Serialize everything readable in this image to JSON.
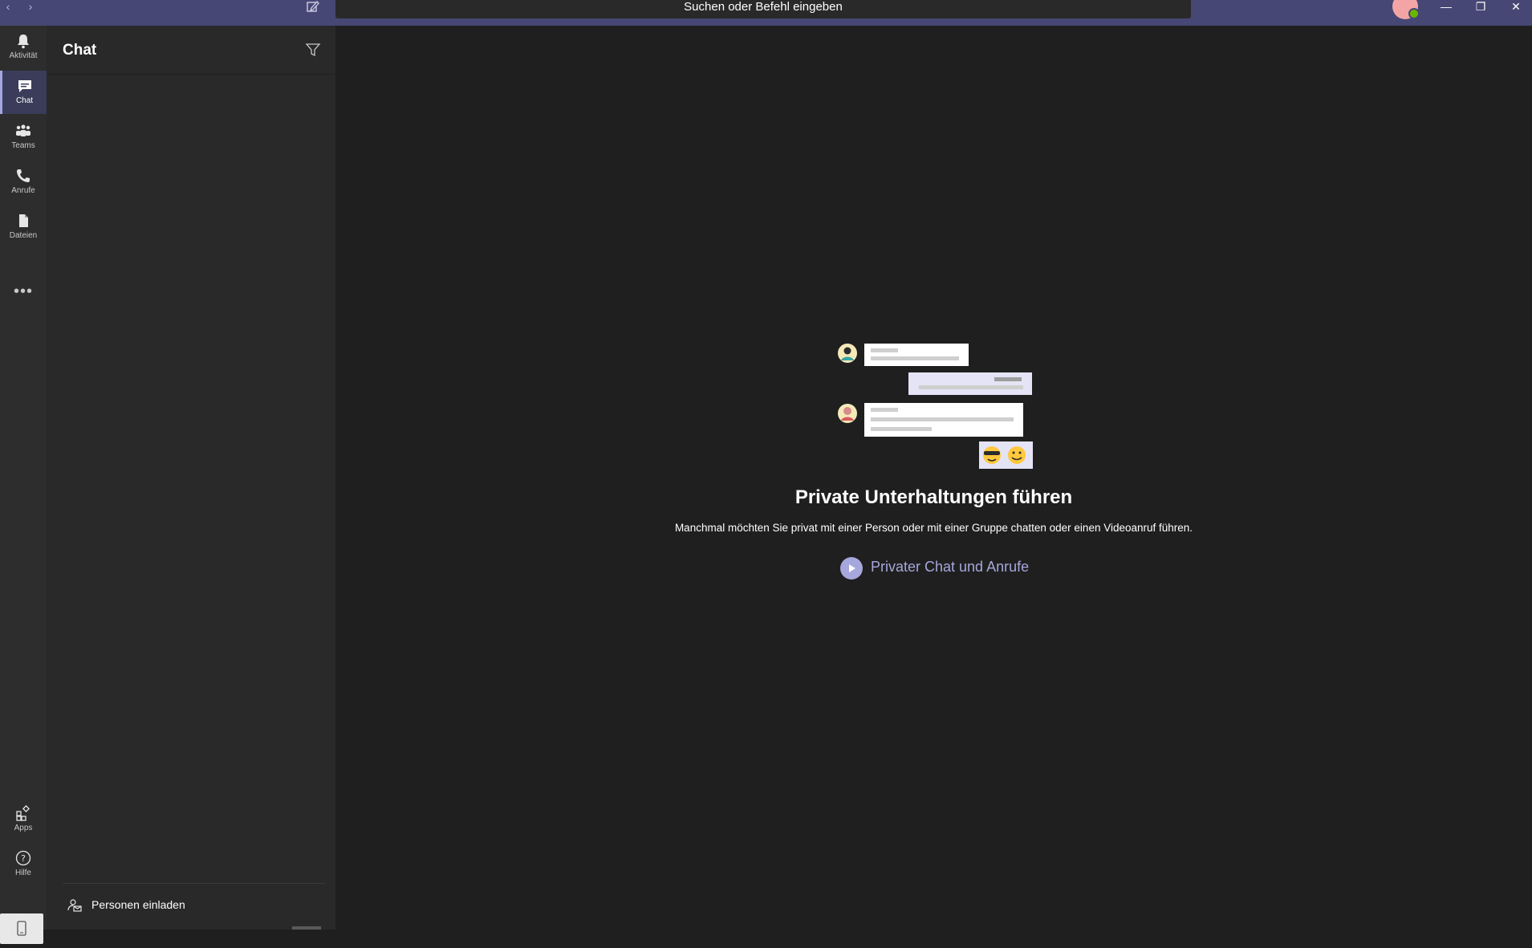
{
  "titlebar": {
    "search_placeholder": "Suchen oder Befehl eingeben",
    "back_icon": "chevron-left",
    "forward_icon": "chevron-right",
    "compose_icon": "new-chat",
    "window_controls": [
      "minimize",
      "restore",
      "close"
    ]
  },
  "rail": {
    "items": [
      {
        "label": "Aktivität",
        "icon": "bell"
      },
      {
        "label": "Chat",
        "icon": "chat-bubble"
      },
      {
        "label": "Teams",
        "icon": "teams"
      },
      {
        "label": "Anrufe",
        "icon": "phone"
      },
      {
        "label": "Dateien",
        "icon": "file"
      }
    ],
    "more": "•••",
    "bottom": [
      {
        "label": "Apps",
        "icon": "apps"
      },
      {
        "label": "Hilfe",
        "icon": "help"
      }
    ],
    "active": "Chat"
  },
  "chat_panel": {
    "title": "Chat",
    "filter_icon": "filter",
    "invite_label": "Personen einladen"
  },
  "main": {
    "title": "Private Unterhaltungen führen",
    "description": "Manchmal möchten Sie privat mit einer Person oder mit einer Gruppe chatten oder einen Videoanruf führen.",
    "video_link": "Privater Chat und Anrufe",
    "emojis": [
      "😎",
      "🙂"
    ]
  },
  "colors": {
    "titlebar": "#464775",
    "accent": "#a6a7dc",
    "rail": "#2d2d2d",
    "panel": "#292929",
    "main": "#1f1f1f"
  }
}
